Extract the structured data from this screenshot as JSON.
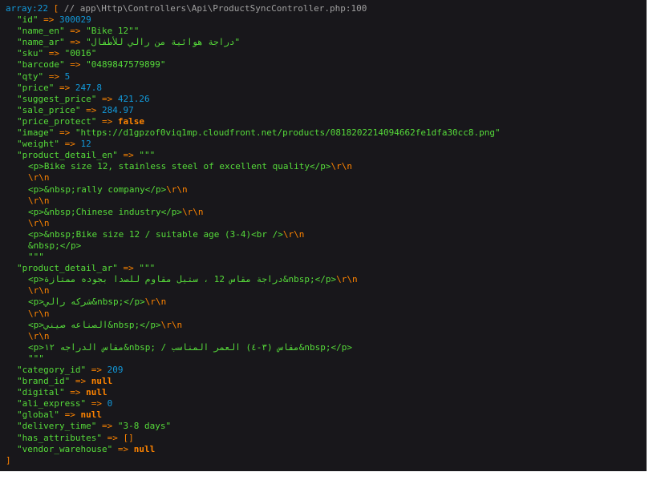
{
  "header": {
    "type_label": "array:22",
    "open": "[",
    "comment": "// app\\Http\\Controllers\\Api\\ProductSyncController.php:100",
    "close": "]"
  },
  "rows": [
    {
      "key": "\"id\"",
      "val": "300029",
      "kind": "num"
    },
    {
      "key": "\"name_en\"",
      "val": "\"Bike 12\"\"",
      "kind": "str"
    },
    {
      "key": "\"name_ar\"",
      "val": "\"دراجة هوائية من رالي للأطفال\"",
      "kind": "str"
    },
    {
      "key": "\"sku\"",
      "val": "\"0016\"",
      "kind": "str"
    },
    {
      "key": "\"barcode\"",
      "val": "\"0489847579899\"",
      "kind": "str"
    },
    {
      "key": "\"qty\"",
      "val": "5",
      "kind": "num"
    },
    {
      "key": "\"price\"",
      "val": "247.8",
      "kind": "num"
    },
    {
      "key": "\"suggest_price\"",
      "val": "421.26",
      "kind": "num"
    },
    {
      "key": "\"sale_price\"",
      "val": "284.97",
      "kind": "num"
    },
    {
      "key": "\"price_protect\"",
      "val": "false",
      "kind": "null"
    },
    {
      "key": "\"image\"",
      "val": "\"https://d1gpzof0viq1mp.cloudfront.net/products/0818202214094662fe1dfa30cc8.png\"",
      "kind": "str"
    },
    {
      "key": "\"weight\"",
      "val": "12",
      "kind": "num"
    }
  ],
  "detail_en": {
    "key": "\"product_detail_en\"",
    "open": "\"\"\"",
    "lines": [
      {
        "html": "<p>Bike size 12, stainless steel of excellent quality</p>",
        "esc": "\\r\\n"
      },
      {
        "html": "",
        "esc": "\\r\\n"
      },
      {
        "html": "<p>&nbsp;rally company</p>",
        "esc": "\\r\\n"
      },
      {
        "html": "",
        "esc": "\\r\\n"
      },
      {
        "html": "<p>&nbsp;Chinese industry</p>",
        "esc": "\\r\\n"
      },
      {
        "html": "",
        "esc": "\\r\\n"
      },
      {
        "html": "<p>&nbsp;Bike size 12 / suitable age (3-4)<br />",
        "esc": "\\r\\n"
      },
      {
        "html": "&nbsp;</p>",
        "esc": ""
      }
    ],
    "close": "\"\"\""
  },
  "detail_ar": {
    "key": "\"product_detail_ar\"",
    "open": "\"\"\"",
    "lines": [
      {
        "html": "<p>دراجة مقاس 12 ، ستيل مقاوم للصدا بجوده ممتازة&nbsp;</p>",
        "esc": "\\r\\n"
      },
      {
        "html": "",
        "esc": "\\r\\n"
      },
      {
        "html": "<p>شركه رالي&nbsp;</p>",
        "esc": "\\r\\n"
      },
      {
        "html": "",
        "esc": "\\r\\n"
      },
      {
        "html": "<p>الصناعه صيني&nbsp;</p>",
        "esc": "\\r\\n"
      },
      {
        "html": "",
        "esc": "\\r\\n"
      },
      {
        "html": "<p>مقاس الدراجه ١٢&nbsp; / مقاس (٣-٤) العمر المناسب&nbsp;</p>",
        "esc": ""
      }
    ],
    "close": "\"\"\""
  },
  "rows2": [
    {
      "key": "\"category_id\"",
      "val": "209",
      "kind": "num"
    },
    {
      "key": "\"brand_id\"",
      "val": "null",
      "kind": "null"
    },
    {
      "key": "\"digital\"",
      "val": "null",
      "kind": "null"
    },
    {
      "key": "\"ali_express\"",
      "val": "0",
      "kind": "num"
    },
    {
      "key": "\"global\"",
      "val": "null",
      "kind": "null"
    },
    {
      "key": "\"delivery_time\"",
      "val": "\"3-8 days\"",
      "kind": "str"
    },
    {
      "key": "\"has_attributes\"",
      "val": "[]",
      "kind": "punc"
    },
    {
      "key": "\"vendor_warehouse\"",
      "val": "null",
      "kind": "null"
    }
  ],
  "arrow": "=>",
  "colors": {
    "background": "#18171b",
    "key": "#56db3a",
    "number": "#1299da",
    "keyword": "#ff8400",
    "punctuation": "#ff8400"
  }
}
